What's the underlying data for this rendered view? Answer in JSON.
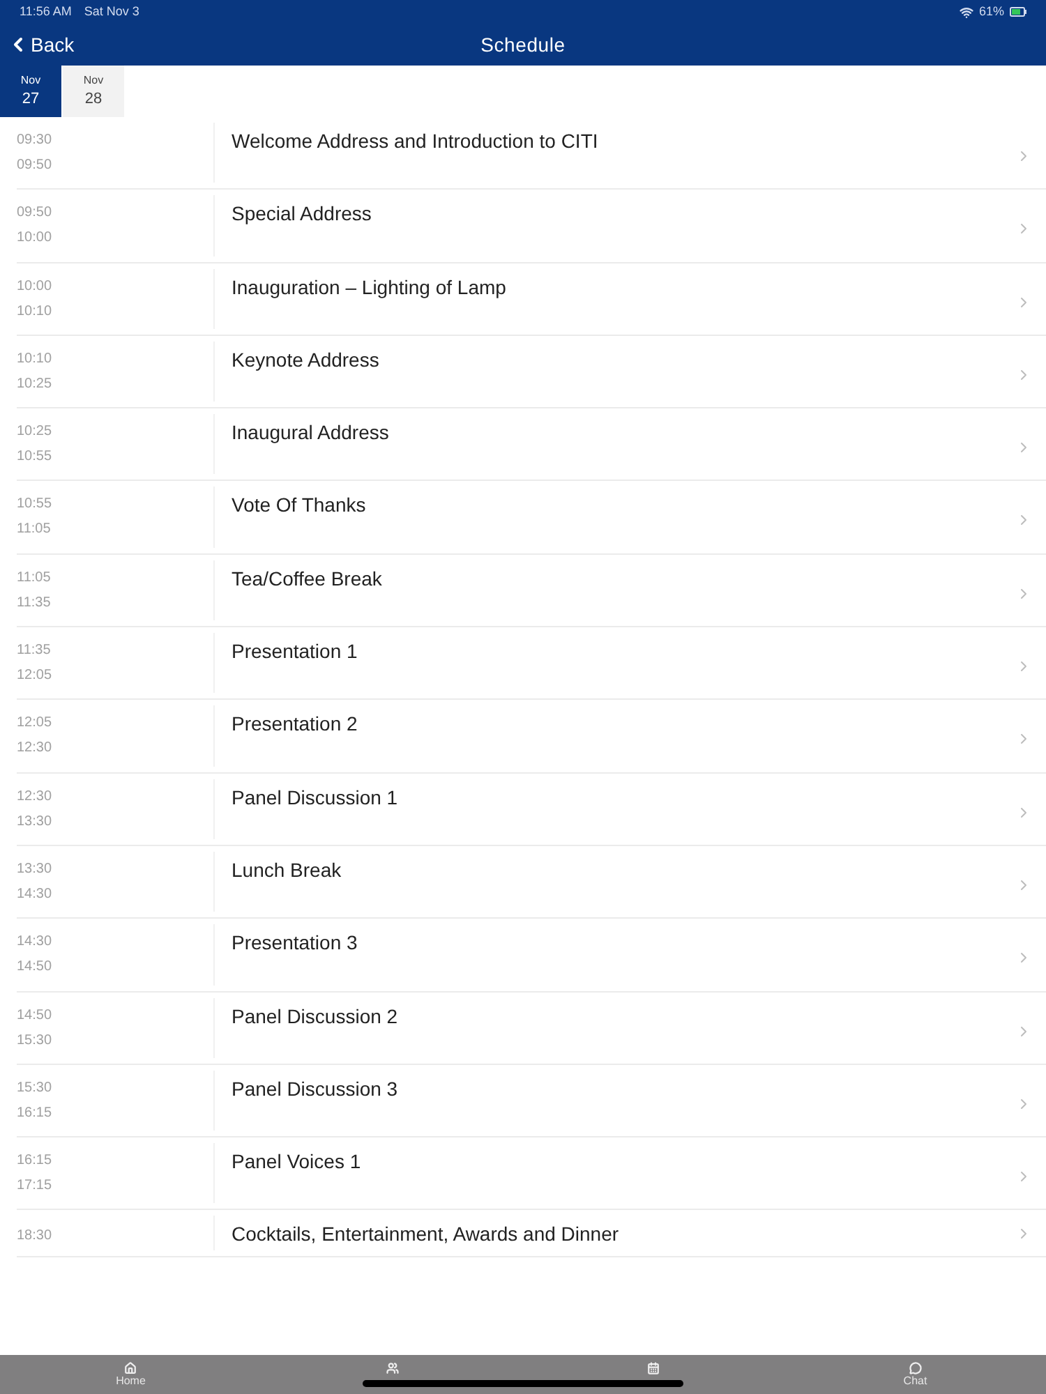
{
  "status_bar": {
    "time": "11:56 AM",
    "date": "Sat Nov 3",
    "battery": "61%"
  },
  "nav": {
    "back": "Back",
    "title": "Schedule"
  },
  "date_tabs": [
    {
      "month": "Nov",
      "day": "27",
      "selected": true
    },
    {
      "month": "Nov",
      "day": "28",
      "selected": false
    }
  ],
  "sessions": [
    {
      "start": "09:30",
      "end": "09:50",
      "title": "Welcome Address and Introduction to CITI"
    },
    {
      "start": "09:50",
      "end": "10:00",
      "title": "Special Address"
    },
    {
      "start": "10:00",
      "end": "10:10",
      "title": "Inauguration – Lighting of Lamp"
    },
    {
      "start": "10:10",
      "end": "10:25",
      "title": "Keynote Address"
    },
    {
      "start": "10:25",
      "end": "10:55",
      "title": "Inaugural Address"
    },
    {
      "start": "10:55",
      "end": "11:05",
      "title": "Vote Of Thanks"
    },
    {
      "start": "11:05",
      "end": "11:35",
      "title": "Tea/Coffee Break"
    },
    {
      "start": "11:35",
      "end": "12:05",
      "title": "Presentation 1"
    },
    {
      "start": "12:05",
      "end": "12:30",
      "title": "Presentation 2"
    },
    {
      "start": "12:30",
      "end": "13:30",
      "title": "Panel Discussion 1"
    },
    {
      "start": "13:30",
      "end": "14:30",
      "title": "Lunch Break"
    },
    {
      "start": "14:30",
      "end": "14:50",
      "title": "Presentation 3"
    },
    {
      "start": "14:50",
      "end": "15:30",
      "title": "Panel Discussion 2"
    },
    {
      "start": "15:30",
      "end": "16:15",
      "title": "Panel Discussion 3"
    },
    {
      "start": "16:15",
      "end": "17:15",
      "title": "Panel Voices 1"
    },
    {
      "start": "18:30",
      "title": "Cocktails, Entertainment, Awards and Dinner"
    }
  ],
  "tab_bar": [
    {
      "kind": "home",
      "label": "Home"
    },
    {
      "kind": "people"
    },
    {
      "kind": "calendar"
    },
    {
      "kind": "chat",
      "label": "Chat"
    }
  ]
}
